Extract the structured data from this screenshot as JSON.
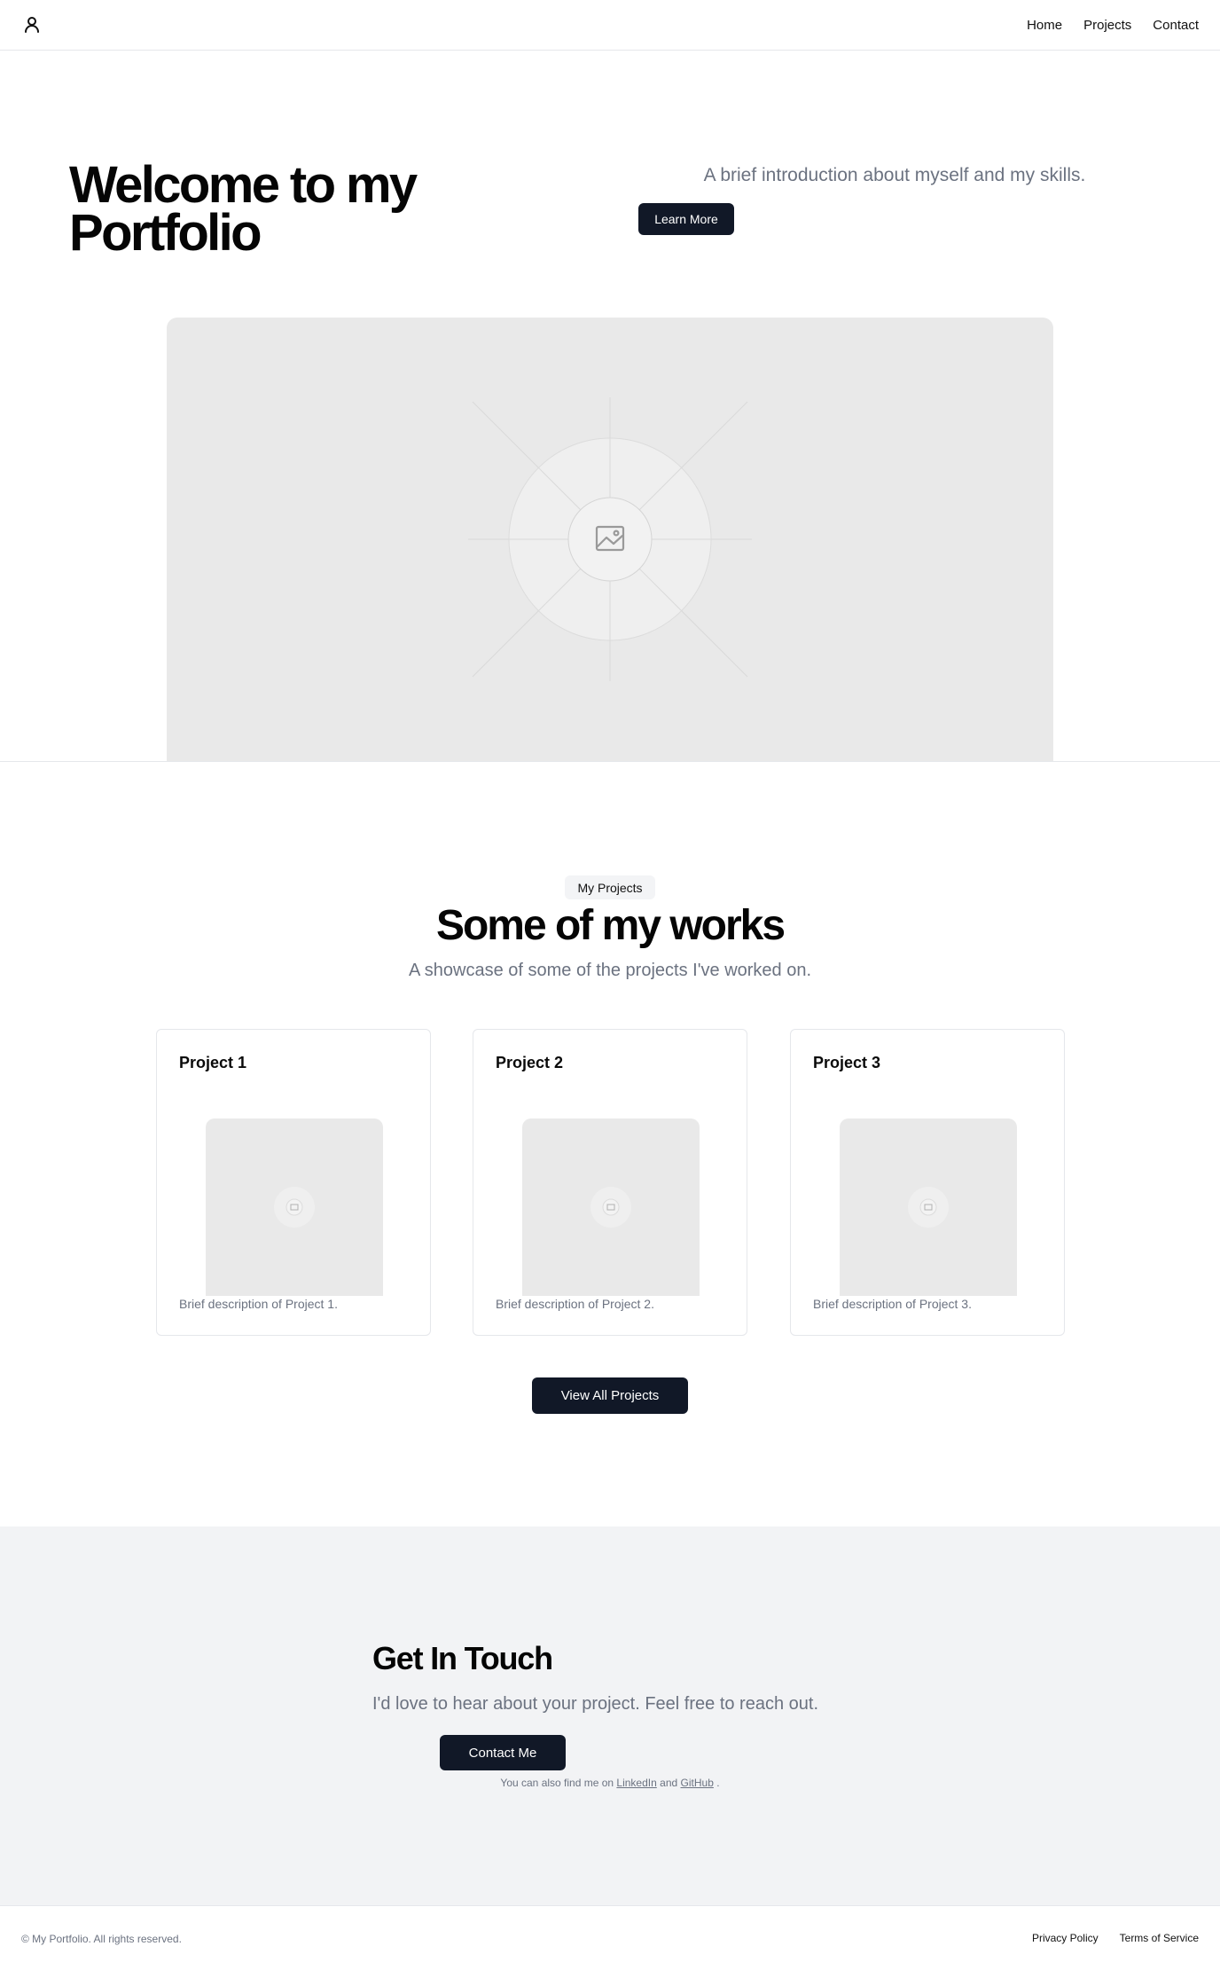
{
  "header": {
    "logo_icon": "user-icon",
    "nav": [
      "Home",
      "Projects",
      "Contact"
    ]
  },
  "hero": {
    "title_line1": "Welcome to my",
    "title_line2": "Portfolio",
    "intro": "A brief introduction about myself and my skills.",
    "cta": "Learn More",
    "image_icon": "image-placeholder-icon"
  },
  "projects": {
    "badge": "My Projects",
    "title": "Some of my works",
    "subtitle": "A showcase of some of the projects I've worked on.",
    "items": [
      {
        "title": "Project 1",
        "description": "Brief description of Project 1."
      },
      {
        "title": "Project 2",
        "description": "Brief description of Project 2."
      },
      {
        "title": "Project 3",
        "description": "Brief description of Project 3."
      }
    ],
    "view_all": "View All Projects"
  },
  "contact": {
    "title": "Get In Touch",
    "subtitle": "I'd love to hear about your project. Feel free to reach out.",
    "button": "Contact Me",
    "note_prefix": "You can also find me on",
    "link_linkedin": "LinkedIn",
    "note_and": "and",
    "link_github": "GitHub",
    "note_suffix": "."
  },
  "footer": {
    "copyright": "© My Portfolio. All rights reserved.",
    "links": [
      "Privacy Policy",
      "Terms of Service"
    ]
  },
  "colors": {
    "primary_button": "#111827",
    "muted_text": "#6b7280",
    "placeholder_bg": "#e9e9e9",
    "contact_bg": "#f2f3f5"
  }
}
